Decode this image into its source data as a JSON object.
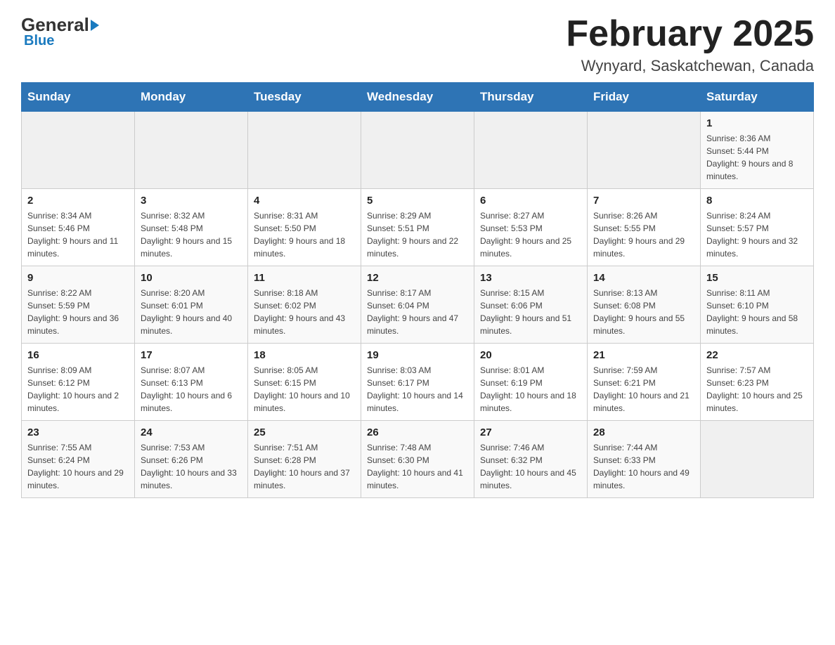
{
  "logo": {
    "general": "General",
    "blue": "Blue",
    "sub": "Blue"
  },
  "title": "February 2025",
  "location": "Wynyard, Saskatchewan, Canada",
  "days_of_week": [
    "Sunday",
    "Monday",
    "Tuesday",
    "Wednesday",
    "Thursday",
    "Friday",
    "Saturday"
  ],
  "weeks": [
    [
      {
        "day": "",
        "info": "",
        "empty": true
      },
      {
        "day": "",
        "info": "",
        "empty": true
      },
      {
        "day": "",
        "info": "",
        "empty": true
      },
      {
        "day": "",
        "info": "",
        "empty": true
      },
      {
        "day": "",
        "info": "",
        "empty": true
      },
      {
        "day": "",
        "info": "",
        "empty": true
      },
      {
        "day": "1",
        "info": "Sunrise: 8:36 AM\nSunset: 5:44 PM\nDaylight: 9 hours and 8 minutes.",
        "empty": false
      }
    ],
    [
      {
        "day": "2",
        "info": "Sunrise: 8:34 AM\nSunset: 5:46 PM\nDaylight: 9 hours and 11 minutes.",
        "empty": false
      },
      {
        "day": "3",
        "info": "Sunrise: 8:32 AM\nSunset: 5:48 PM\nDaylight: 9 hours and 15 minutes.",
        "empty": false
      },
      {
        "day": "4",
        "info": "Sunrise: 8:31 AM\nSunset: 5:50 PM\nDaylight: 9 hours and 18 minutes.",
        "empty": false
      },
      {
        "day": "5",
        "info": "Sunrise: 8:29 AM\nSunset: 5:51 PM\nDaylight: 9 hours and 22 minutes.",
        "empty": false
      },
      {
        "day": "6",
        "info": "Sunrise: 8:27 AM\nSunset: 5:53 PM\nDaylight: 9 hours and 25 minutes.",
        "empty": false
      },
      {
        "day": "7",
        "info": "Sunrise: 8:26 AM\nSunset: 5:55 PM\nDaylight: 9 hours and 29 minutes.",
        "empty": false
      },
      {
        "day": "8",
        "info": "Sunrise: 8:24 AM\nSunset: 5:57 PM\nDaylight: 9 hours and 32 minutes.",
        "empty": false
      }
    ],
    [
      {
        "day": "9",
        "info": "Sunrise: 8:22 AM\nSunset: 5:59 PM\nDaylight: 9 hours and 36 minutes.",
        "empty": false
      },
      {
        "day": "10",
        "info": "Sunrise: 8:20 AM\nSunset: 6:01 PM\nDaylight: 9 hours and 40 minutes.",
        "empty": false
      },
      {
        "day": "11",
        "info": "Sunrise: 8:18 AM\nSunset: 6:02 PM\nDaylight: 9 hours and 43 minutes.",
        "empty": false
      },
      {
        "day": "12",
        "info": "Sunrise: 8:17 AM\nSunset: 6:04 PM\nDaylight: 9 hours and 47 minutes.",
        "empty": false
      },
      {
        "day": "13",
        "info": "Sunrise: 8:15 AM\nSunset: 6:06 PM\nDaylight: 9 hours and 51 minutes.",
        "empty": false
      },
      {
        "day": "14",
        "info": "Sunrise: 8:13 AM\nSunset: 6:08 PM\nDaylight: 9 hours and 55 minutes.",
        "empty": false
      },
      {
        "day": "15",
        "info": "Sunrise: 8:11 AM\nSunset: 6:10 PM\nDaylight: 9 hours and 58 minutes.",
        "empty": false
      }
    ],
    [
      {
        "day": "16",
        "info": "Sunrise: 8:09 AM\nSunset: 6:12 PM\nDaylight: 10 hours and 2 minutes.",
        "empty": false
      },
      {
        "day": "17",
        "info": "Sunrise: 8:07 AM\nSunset: 6:13 PM\nDaylight: 10 hours and 6 minutes.",
        "empty": false
      },
      {
        "day": "18",
        "info": "Sunrise: 8:05 AM\nSunset: 6:15 PM\nDaylight: 10 hours and 10 minutes.",
        "empty": false
      },
      {
        "day": "19",
        "info": "Sunrise: 8:03 AM\nSunset: 6:17 PM\nDaylight: 10 hours and 14 minutes.",
        "empty": false
      },
      {
        "day": "20",
        "info": "Sunrise: 8:01 AM\nSunset: 6:19 PM\nDaylight: 10 hours and 18 minutes.",
        "empty": false
      },
      {
        "day": "21",
        "info": "Sunrise: 7:59 AM\nSunset: 6:21 PM\nDaylight: 10 hours and 21 minutes.",
        "empty": false
      },
      {
        "day": "22",
        "info": "Sunrise: 7:57 AM\nSunset: 6:23 PM\nDaylight: 10 hours and 25 minutes.",
        "empty": false
      }
    ],
    [
      {
        "day": "23",
        "info": "Sunrise: 7:55 AM\nSunset: 6:24 PM\nDaylight: 10 hours and 29 minutes.",
        "empty": false
      },
      {
        "day": "24",
        "info": "Sunrise: 7:53 AM\nSunset: 6:26 PM\nDaylight: 10 hours and 33 minutes.",
        "empty": false
      },
      {
        "day": "25",
        "info": "Sunrise: 7:51 AM\nSunset: 6:28 PM\nDaylight: 10 hours and 37 minutes.",
        "empty": false
      },
      {
        "day": "26",
        "info": "Sunrise: 7:48 AM\nSunset: 6:30 PM\nDaylight: 10 hours and 41 minutes.",
        "empty": false
      },
      {
        "day": "27",
        "info": "Sunrise: 7:46 AM\nSunset: 6:32 PM\nDaylight: 10 hours and 45 minutes.",
        "empty": false
      },
      {
        "day": "28",
        "info": "Sunrise: 7:44 AM\nSunset: 6:33 PM\nDaylight: 10 hours and 49 minutes.",
        "empty": false
      },
      {
        "day": "",
        "info": "",
        "empty": true
      }
    ]
  ]
}
